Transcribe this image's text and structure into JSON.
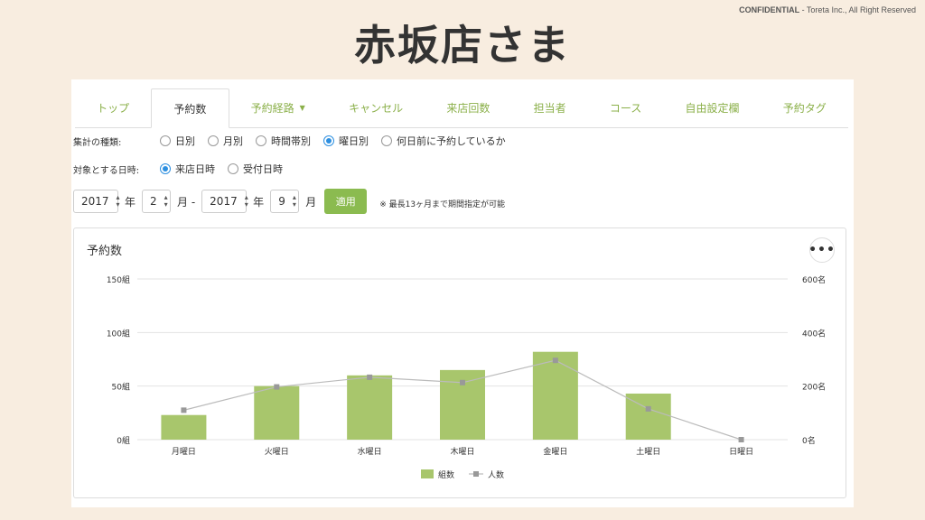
{
  "slide": {
    "title": "赤坂店さま",
    "confidential_label": "CONFIDENTIAL",
    "confidential_text": " - Toreta Inc., All Right Reserved"
  },
  "tabs": [
    {
      "label": "トップ",
      "active": false
    },
    {
      "label": "予約数",
      "active": true
    },
    {
      "label": "予約経路",
      "active": false,
      "caret": "▼"
    },
    {
      "label": "キャンセル",
      "active": false
    },
    {
      "label": "来店回数",
      "active": false
    },
    {
      "label": "担当者",
      "active": false
    },
    {
      "label": "コース",
      "active": false
    },
    {
      "label": "自由設定欄",
      "active": false
    },
    {
      "label": "予約タグ",
      "active": false
    }
  ],
  "filters": {
    "aggregation_label": "集計の種類:",
    "aggregation_options": [
      "日別",
      "月別",
      "時間帯別",
      "曜日別",
      "何日前に予約しているか"
    ],
    "aggregation_selected": "曜日別",
    "date_target_label": "対象とする日時:",
    "date_target_options": [
      "来店日時",
      "受付日時"
    ],
    "date_target_selected": "来店日時"
  },
  "range": {
    "from_year": "2017",
    "from_month": "2",
    "to_year": "2017",
    "to_month": "9",
    "year_unit": "年",
    "month_unit": "月",
    "month_unit_dash": "月 -",
    "apply_label": "適用",
    "note": "※ 最長13ヶ月まで期間指定が可能"
  },
  "chart_panel": {
    "title": "予約数",
    "menu_icon": "more-horizontal-icon",
    "menu_glyph": "•••"
  },
  "chart_data": {
    "type": "bar",
    "categories": [
      "月曜日",
      "火曜日",
      "水曜日",
      "木曜日",
      "金曜日",
      "土曜日",
      "日曜日"
    ],
    "series": [
      {
        "name": "組数",
        "type": "bar",
        "axis": "left",
        "color": "#a8c66c",
        "values": [
          23,
          50,
          60,
          65,
          82,
          43,
          0
        ]
      },
      {
        "name": "人数",
        "type": "line",
        "axis": "right",
        "color": "#bbbbbb",
        "marker_color": "#999999",
        "values": [
          110,
          197,
          233,
          213,
          296,
          115,
          0
        ]
      }
    ],
    "left_axis": {
      "ticks": [
        "0組",
        "50組",
        "100組",
        "150組"
      ],
      "ylim": [
        0,
        150
      ]
    },
    "right_axis": {
      "ticks": [
        "0名",
        "200名",
        "400名",
        "600名"
      ],
      "ylim": [
        0,
        600
      ]
    },
    "grid": true,
    "legend_position": "bottom"
  }
}
